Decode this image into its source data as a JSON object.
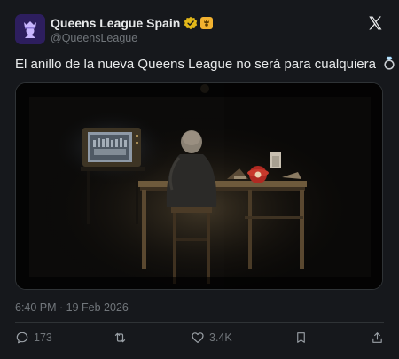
{
  "author": {
    "display_name": "Queens League Spain",
    "handle": "@QueensLeague",
    "avatar_icon": "queens-league-crest-icon",
    "verified_icon": "verified-gold-badge-icon",
    "affiliate_icon": "affiliate-badge-icon"
  },
  "tweet": {
    "text": "El anillo de la nueva Queens League no será para cualquiera",
    "emoji_icon": "ring-icon",
    "timestamp": "6:40 PM · 19 Feb 2026"
  },
  "media": {
    "type": "image",
    "scene_icon": "dark-room-tv-desk-scene"
  },
  "actions": {
    "reply": {
      "icon": "reply-icon",
      "count": "173"
    },
    "retweet": {
      "icon": "retweet-icon",
      "count": ""
    },
    "like": {
      "icon": "heart-icon",
      "count": "3.4K"
    },
    "bookmark": {
      "icon": "bookmark-icon"
    },
    "share": {
      "icon": "share-icon"
    }
  },
  "colors": {
    "background": "#16181c",
    "text_primary": "#e7e9ea",
    "text_secondary": "#71767b",
    "verified_gold": "#e2b719",
    "avatar_purple": "#2d1e5e"
  }
}
